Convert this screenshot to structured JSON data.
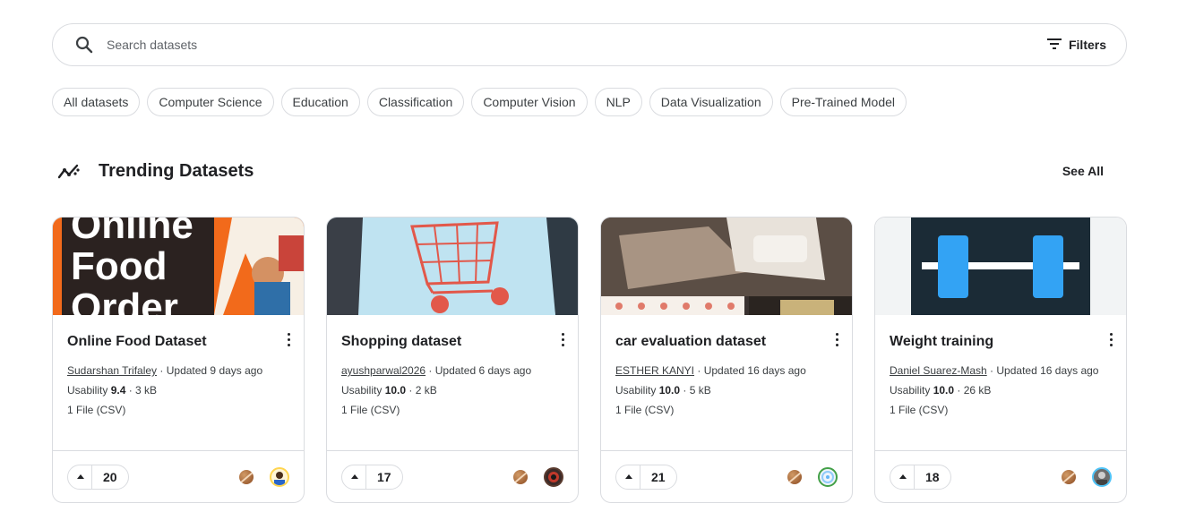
{
  "search": {
    "placeholder": "Search datasets",
    "filters_label": "Filters"
  },
  "chips": [
    "All datasets",
    "Computer Science",
    "Education",
    "Classification",
    "Computer Vision",
    "NLP",
    "Data Visualization",
    "Pre-Trained Model"
  ],
  "section": {
    "title": "Trending Datasets",
    "see_all": "See All"
  },
  "thumb_text": {
    "line1": "Online",
    "line2": "Food",
    "line3": "Order"
  },
  "cards": [
    {
      "title": "Online Food Dataset",
      "author": "Sudarshan Trifaley",
      "updated": " · Updated 9 days ago",
      "usability_label": "Usability ",
      "usability": "9.4",
      "size": " · 3 kB",
      "files": "1 File (CSV)",
      "votes": "20"
    },
    {
      "title": "Shopping dataset",
      "author": "ayushparwal2026",
      "updated": " · Updated 6 days ago",
      "usability_label": "Usability ",
      "usability": "10.0",
      "size": " · 2 kB",
      "files": "1 File (CSV)",
      "votes": "17"
    },
    {
      "title": "car evaluation dataset",
      "author": "ESTHER KANYI",
      "updated": " · Updated 16 days ago",
      "usability_label": "Usability ",
      "usability": "10.0",
      "size": " · 5 kB",
      "files": "1 File (CSV)",
      "votes": "21"
    },
    {
      "title": "Weight training",
      "author": "Daniel Suarez-Mash",
      "updated": " · Updated 16 days ago",
      "usability_label": "Usability ",
      "usability": "10.0",
      "size": " · 26 kB",
      "files": "1 File (CSV)",
      "votes": "18"
    }
  ],
  "icons": {
    "search": "search-icon",
    "filters": "filter-icon",
    "trending": "trending-icon",
    "menu": "more-vert-icon",
    "upvote": "upvote-icon",
    "medal": "bronze-medal-icon",
    "avatar": "user-avatar"
  },
  "colors": {
    "border": "#dadce0",
    "text": "#202124",
    "accent_orange": "#f26a1b",
    "weight_bg": "#1b2b36",
    "weight_blue": "#33a3f4"
  }
}
